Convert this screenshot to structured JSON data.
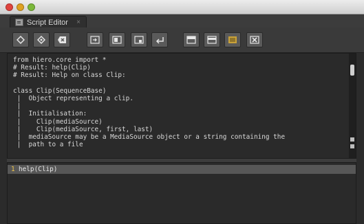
{
  "window": {
    "controls": [
      "close",
      "minimize",
      "maximize"
    ]
  },
  "tab": {
    "label": "Script Editor",
    "close_glyph": "×",
    "icon": "script-editor-icon"
  },
  "toolbar": {
    "buttons": [
      {
        "name": "previous-script-button",
        "icon": "diamond-icon"
      },
      {
        "name": "next-script-button",
        "icon": "diamond-dot-icon"
      },
      {
        "name": "clear-history-button",
        "icon": "clear-x-icon"
      },
      {
        "name": "source-script-button",
        "icon": "load-script-icon"
      },
      {
        "name": "load-script-button",
        "icon": "open-script-icon"
      },
      {
        "name": "save-script-button",
        "icon": "save-script-icon"
      },
      {
        "name": "run-script-button",
        "icon": "enter-arrow-icon"
      },
      {
        "name": "show-input-output-button",
        "icon": "split-top-icon"
      },
      {
        "name": "show-output-only-button",
        "icon": "split-bottom-icon"
      },
      {
        "name": "show-input-only-button",
        "icon": "list-icon"
      },
      {
        "name": "clear-output-button",
        "icon": "close-box-icon"
      }
    ]
  },
  "output": {
    "lines": [
      "from hiero.core import *",
      "# Result: help(Clip)",
      "# Result: Help on class Clip:",
      "",
      "class Clip(SequenceBase)",
      " |  Object representing a clip.",
      " |",
      " |  Initialisation:",
      " |    Clip(mediaSource)",
      " |    Clip(mediaSource, first, last)",
      " |  mediaSource may be a MediaSource object or a string containing the",
      " |  path to a file"
    ]
  },
  "input": {
    "line_number": "1",
    "text": "help(Clip)"
  },
  "colors": {
    "background": "#2b2b2b",
    "line_number": "#f0c64a",
    "current_line": "#575757"
  }
}
